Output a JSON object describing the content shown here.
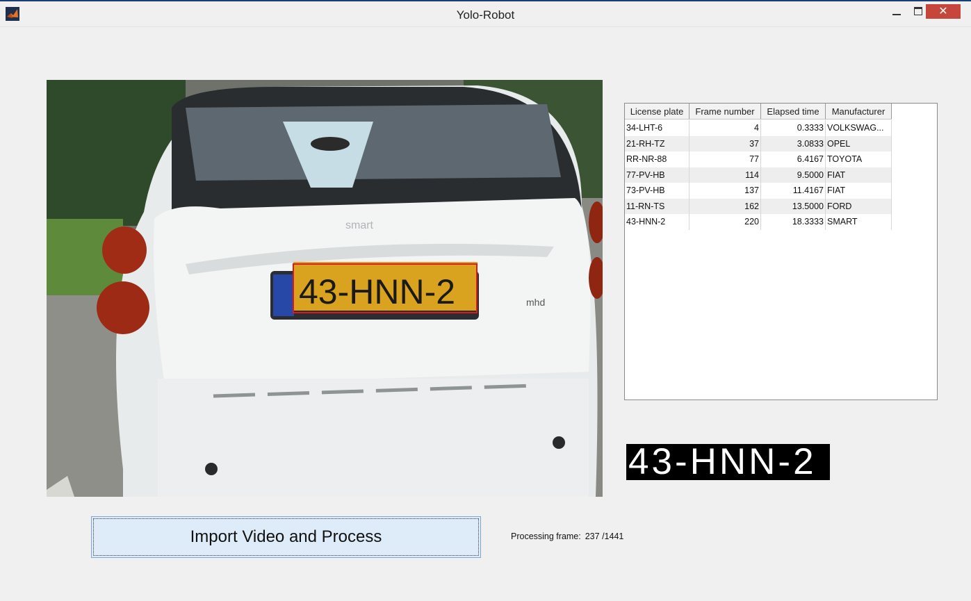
{
  "window": {
    "title": "Yolo-Robot",
    "close_glyph": "✕"
  },
  "video": {
    "detected_plate_overlay": "43-HNN-2"
  },
  "table": {
    "columns": [
      "License plate",
      "Frame number",
      "Elapsed time",
      "Manufacturer"
    ],
    "rows": [
      [
        "34-LHT-6",
        "4",
        "0.3333",
        "VOLKSWAG..."
      ],
      [
        "21-RH-TZ",
        "37",
        "3.0833",
        "OPEL"
      ],
      [
        "RR-NR-88",
        "77",
        "6.4167",
        "TOYOTA"
      ],
      [
        "77-PV-HB",
        "114",
        "9.5000",
        "FIAT"
      ],
      [
        "73-PV-HB",
        "137",
        "11.4167",
        "FIAT"
      ],
      [
        "11-RN-TS",
        "162",
        "13.5000",
        "FORD"
      ],
      [
        "43-HNN-2",
        "220",
        "18.3333",
        "SMART"
      ]
    ]
  },
  "plate_crop": {
    "text": "43-HNN-2"
  },
  "controls": {
    "import_label": "Import Video and Process",
    "status_label": "Processing frame:",
    "status_value": "237 /1441"
  },
  "colors": {
    "bounding_box": "#e01818",
    "button_face": "#deebf8",
    "plate_yellow": "#d9a21f"
  }
}
